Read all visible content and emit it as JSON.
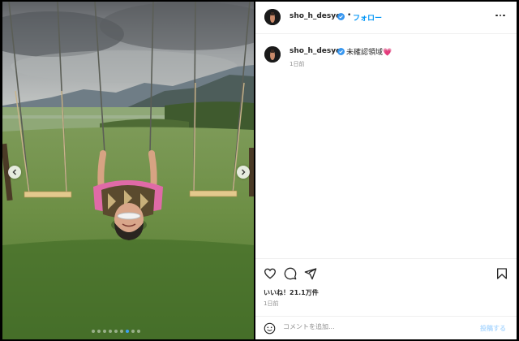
{
  "post": {
    "username": "sho_h_desyo",
    "follow_label": "フォロー",
    "separator": "•",
    "caption": "未確認領域💗",
    "caption_time": "1日前",
    "likes": "いいね！21.1万件",
    "post_time": "1日前"
  },
  "comment": {
    "placeholder": "コメントを追加...",
    "post_label": "投稿する"
  },
  "carousel": {
    "dot_count": 9,
    "active_index": 6
  },
  "icons": {
    "verified": "verified-badge-icon",
    "more": "more-options-icon",
    "like": "heart-icon",
    "comment": "comment-icon",
    "share": "paper-plane-icon",
    "save": "bookmark-icon",
    "emoji": "emoji-icon",
    "prev": "chevron-left-icon",
    "next": "chevron-right-icon"
  },
  "colors": {
    "accent": "#0095f6",
    "verified": "#3897f0",
    "post_button_disabled": "#b3dbff"
  }
}
